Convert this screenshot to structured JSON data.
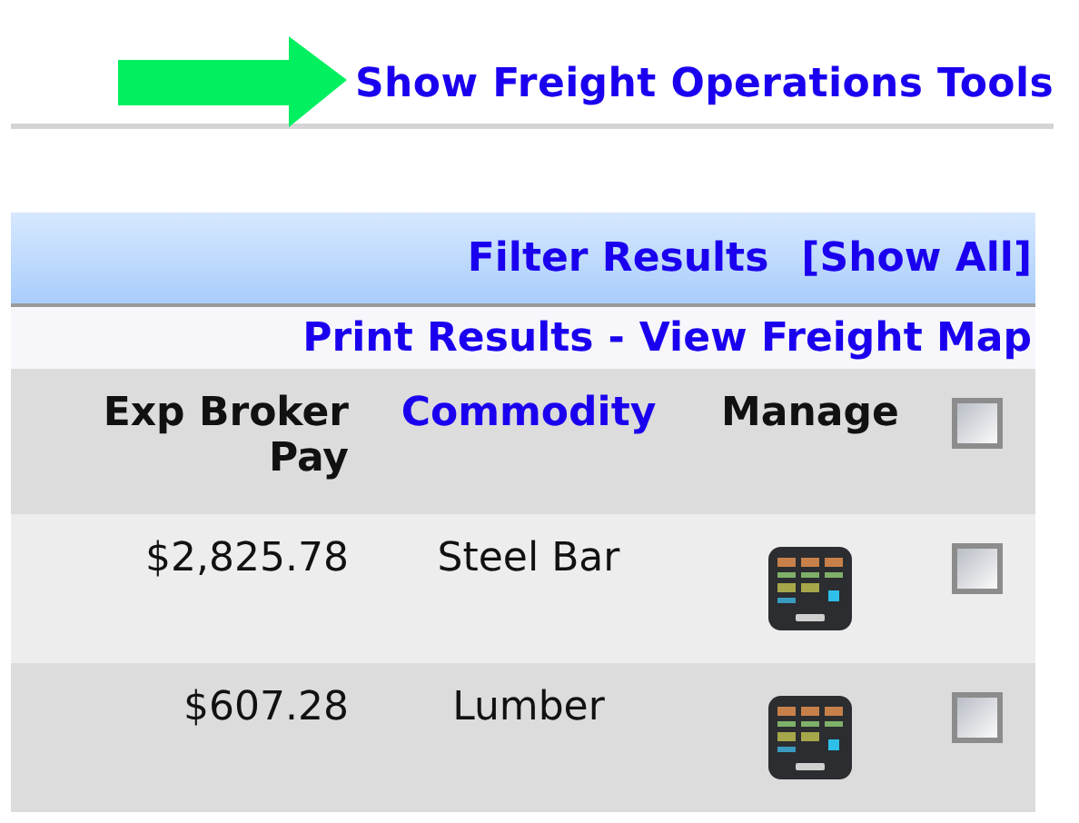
{
  "top_link": "Show Freight Operations Tools",
  "filter_bar": {
    "filter_link": "Filter Results",
    "show_all_link": "[Show All]"
  },
  "actions": {
    "print_link": "Print Results",
    "separator": "-",
    "map_link": "View Freight Map"
  },
  "table": {
    "columns": [
      {
        "label": "Exp Broker Pay",
        "kind": "text"
      },
      {
        "label": "Commodity",
        "kind": "link"
      },
      {
        "label": "Manage",
        "kind": "text"
      }
    ],
    "select_all": {
      "checked": false
    },
    "rows": [
      {
        "broker_pay": "$2,825.78",
        "commodity": "Steel Bar",
        "checked": false
      },
      {
        "broker_pay": "$607.28",
        "commodity": "Lumber",
        "checked": false
      }
    ]
  }
}
